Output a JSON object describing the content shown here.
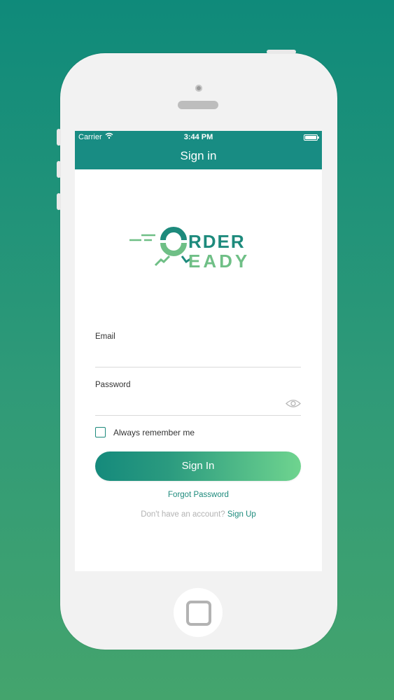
{
  "status_bar": {
    "carrier": "Carrier",
    "time": "3:44 PM"
  },
  "header": {
    "title": "Sign in"
  },
  "logo": {
    "line1": "RDER",
    "line2": "EADY"
  },
  "form": {
    "email_label": "Email",
    "email_value": "",
    "password_label": "Password",
    "password_value": "",
    "remember_label": "Always remember me",
    "remember_checked": false,
    "signin_label": "Sign In",
    "forgot_label": "Forgot Password",
    "no_account_text": "Don't have an account?",
    "signup_label": "Sign Up"
  },
  "colors": {
    "teal": "#188c83",
    "green_light": "#6fd48f",
    "logo_teal": "#1d8a7c",
    "logo_green": "#6fbf86"
  }
}
